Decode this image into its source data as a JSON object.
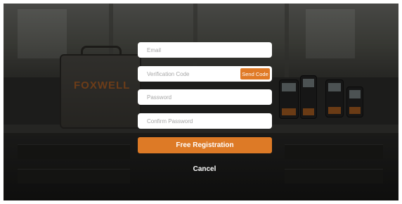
{
  "form": {
    "email": {
      "placeholder": "Email",
      "value": ""
    },
    "verification_code": {
      "placeholder": "Verification Code",
      "value": ""
    },
    "send_code_label": "Send Code",
    "password": {
      "placeholder": "Password",
      "value": ""
    },
    "confirm_password": {
      "placeholder": "Confirm Password",
      "value": ""
    },
    "register_label": "Free Registration",
    "cancel_label": "Cancel"
  },
  "background": {
    "case_brand": "FOXWELL"
  },
  "colors": {
    "accent": "#dd7a26",
    "field_bg": "#ffffff",
    "placeholder": "#a7a7a7"
  }
}
